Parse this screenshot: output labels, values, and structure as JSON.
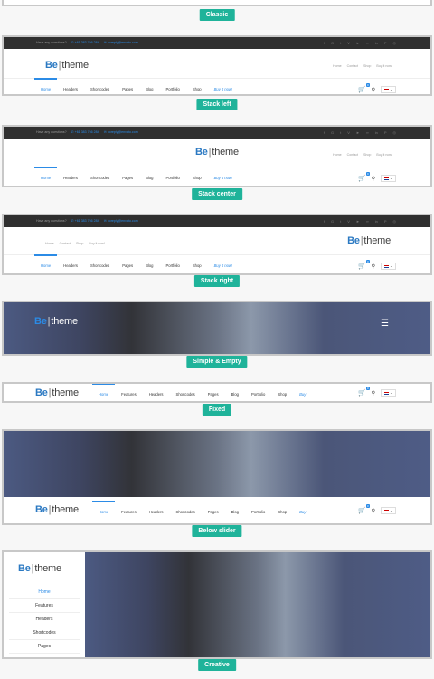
{
  "labels": {
    "classic": "Classic",
    "stack_left": "Stack left",
    "stack_center": "Stack center",
    "stack_right": "Stack right",
    "simple_empty": "Simple & Empty",
    "fixed": "Fixed",
    "below_slider": "Below slider",
    "creative": "Creative"
  },
  "topbar": {
    "question": "Have any questions?",
    "phone": "+61 383 766 284",
    "email": "noreply@envato.com",
    "social": [
      "f",
      "G",
      "t",
      "V",
      "►",
      "∞",
      "in",
      "P",
      "◎"
    ]
  },
  "logo": {
    "be": "Be",
    "sep": "|",
    "theme": "theme"
  },
  "menu_stack": [
    "Home",
    "Headers",
    "Shortcodes",
    "Pages",
    "Blog",
    "Portfolio",
    "Shop",
    "Buy it now!"
  ],
  "menu_fixed": [
    "Home",
    "Features",
    "Headers",
    "Shortcodes",
    "Pages",
    "Blog",
    "Portfolio",
    "Shop",
    "Buy"
  ],
  "secondary_links": [
    "Home",
    "Contact",
    "Shop",
    "Buy it now!"
  ],
  "cart_count": "0",
  "creative_menu": [
    "Home",
    "Features",
    "Headers",
    "Shortcodes",
    "Pages"
  ],
  "colors": {
    "accent": "#2b8be6",
    "label_bg": "#1fb39a",
    "topbar": "#2f2f2f"
  }
}
